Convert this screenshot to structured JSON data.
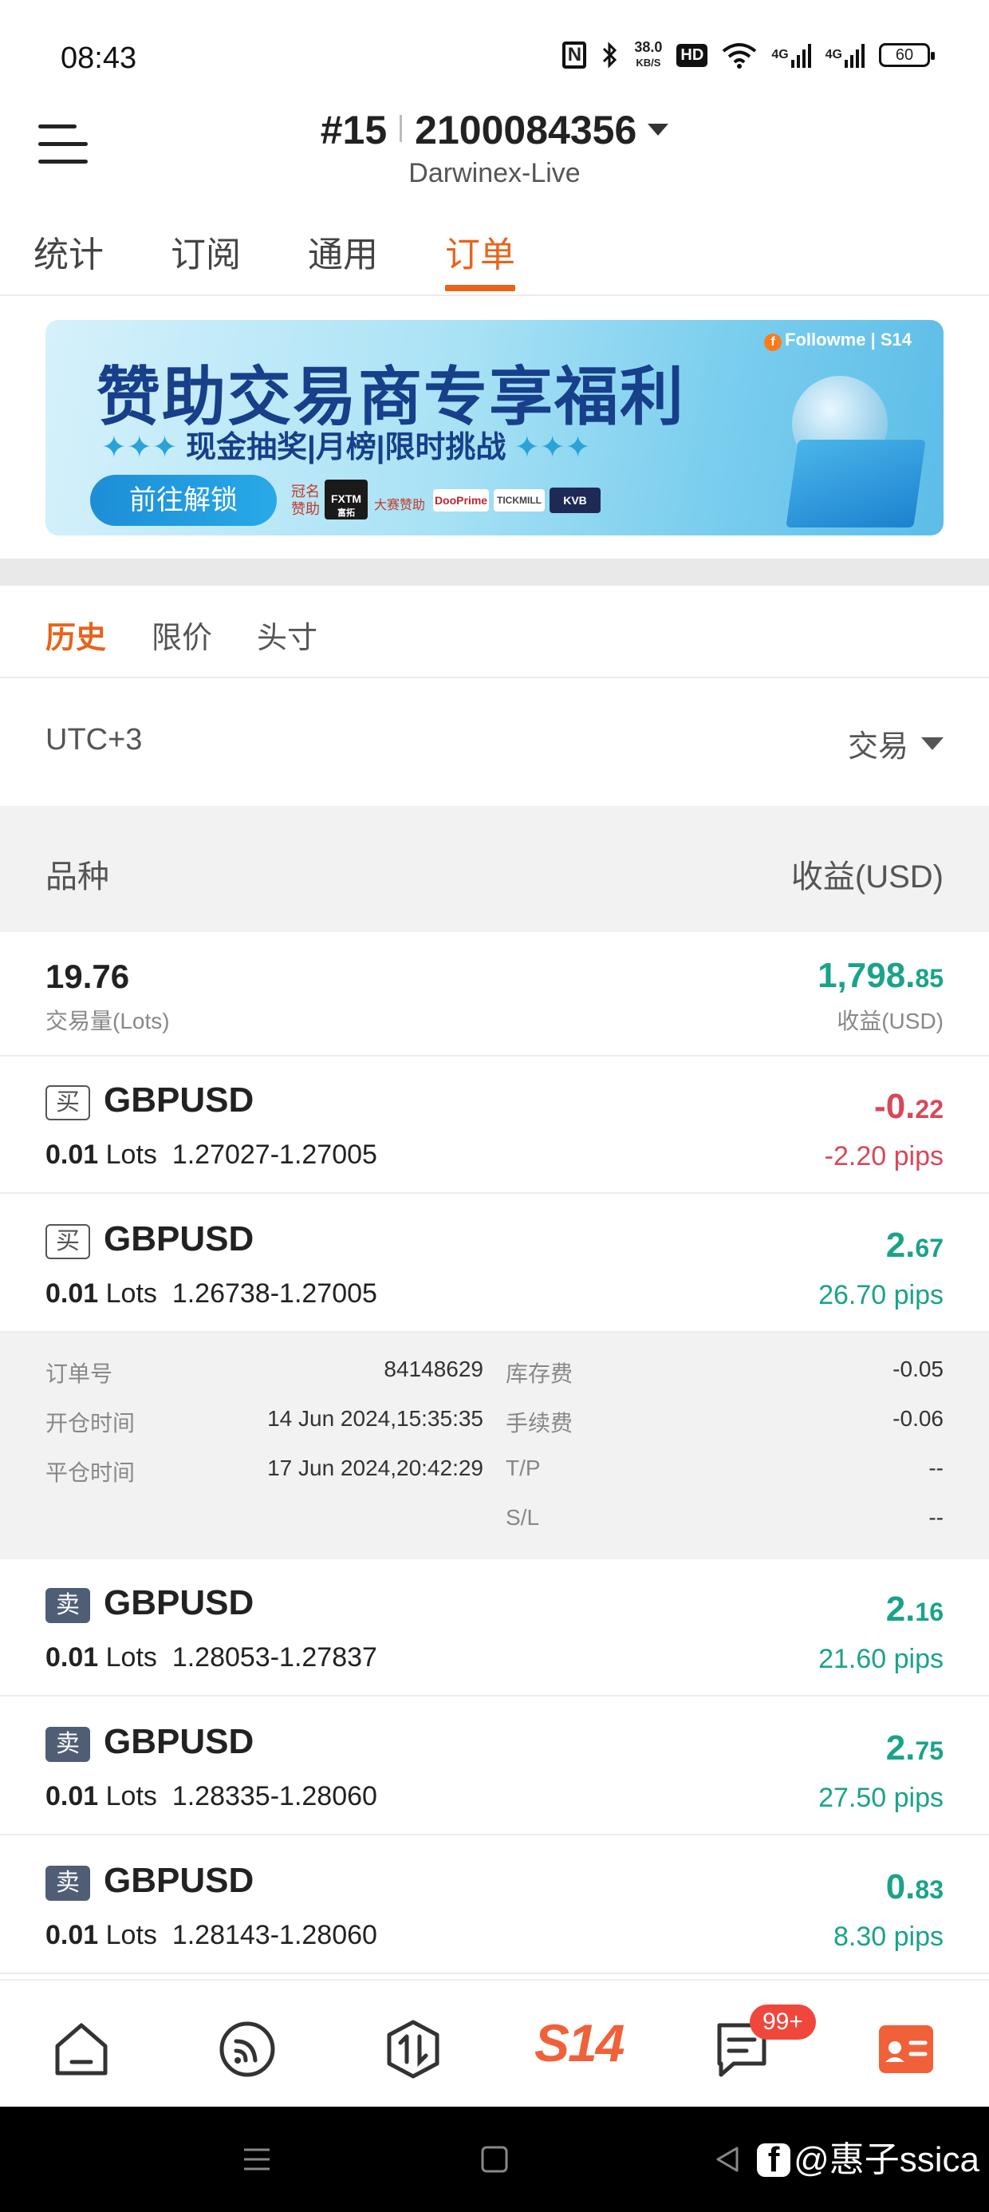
{
  "status_bar": {
    "time": "08:43",
    "nfc": "N",
    "speed_value": "38.0",
    "speed_unit": "KB/S",
    "hd": "HD",
    "signal1": "4G",
    "signal2": "4G",
    "battery": "60"
  },
  "header": {
    "account_index": "#15",
    "account_number": "2100084356",
    "broker": "Darwinex-Live"
  },
  "top_tabs": [
    {
      "label": "统计"
    },
    {
      "label": "订阅"
    },
    {
      "label": "通用"
    },
    {
      "label": "订单"
    }
  ],
  "top_tab_active": "订单",
  "banner": {
    "title": "赞助交易商专享福利",
    "subtitle": "现金抽奖|月榜|限时挑战",
    "button": "前往解锁",
    "sponsor_label": "冠名赞助",
    "sponsor_label2": "大赛赞助",
    "sponsor_fxtm": "FXTM",
    "sponsor_fxtm_sub": "富拓",
    "sponsor_2": "DooPrime",
    "sponsor_3": "TICKMILL",
    "sponsor_4": "KVB",
    "brand": "Followme",
    "brand_tag": "S14"
  },
  "sub_tabs": [
    {
      "label": "历史"
    },
    {
      "label": "限价"
    },
    {
      "label": "头寸"
    }
  ],
  "sub_tab_active": "历史",
  "filter": {
    "timezone": "UTC+3",
    "type_select": "交易"
  },
  "columns": {
    "left": "品种",
    "right": "收益(USD)"
  },
  "summary": {
    "volume": "19.76",
    "volume_label": "交易量(Lots)",
    "profit_main": "1,798.",
    "profit_decimal": "85",
    "profit_label": "收益(USD)"
  },
  "orders": [
    {
      "side": "买",
      "symbol": "GBPUSD",
      "lots": "0.01",
      "lots_unit": "Lots",
      "prices": "1.27027-1.27005",
      "pnl_main": "-0.",
      "pnl_decimal": "22",
      "pips": "-2.20 pips",
      "sign": "neg"
    },
    {
      "side": "买",
      "symbol": "GBPUSD",
      "lots": "0.01",
      "lots_unit": "Lots",
      "prices": "1.26738-1.27005",
      "pnl_main": "2.",
      "pnl_decimal": "67",
      "pips": "26.70 pips",
      "sign": "pos"
    },
    {
      "side": "卖",
      "symbol": "GBPUSD",
      "lots": "0.01",
      "lots_unit": "Lots",
      "prices": "1.28053-1.27837",
      "pnl_main": "2.",
      "pnl_decimal": "16",
      "pips": "21.60 pips",
      "sign": "pos"
    },
    {
      "side": "卖",
      "symbol": "GBPUSD",
      "lots": "0.01",
      "lots_unit": "Lots",
      "prices": "1.28335-1.28060",
      "pnl_main": "2.",
      "pnl_decimal": "75",
      "pips": "27.50 pips",
      "sign": "pos"
    },
    {
      "side": "卖",
      "symbol": "GBPUSD",
      "lots": "0.01",
      "lots_unit": "Lots",
      "prices": "1.28143-1.28060",
      "pnl_main": "0.",
      "pnl_decimal": "83",
      "pips": "8.30 pips",
      "sign": "pos"
    }
  ],
  "detail": {
    "order_no_label": "订单号",
    "order_no": "84148629",
    "open_time_label": "开仓时间",
    "open_time": "14 Jun 2024,15:35:35",
    "close_time_label": "平仓时间",
    "close_time": "17 Jun 2024,20:42:29",
    "swap_label": "库存费",
    "swap": "-0.05",
    "commission_label": "手续费",
    "commission": "-0.06",
    "tp_label": "T/P",
    "tp": "--",
    "sl_label": "S/L",
    "sl": "--"
  },
  "bottom_nav": {
    "items": [
      "home-icon",
      "feed-icon",
      "trade-icon",
      "s14-logo",
      "messages-icon",
      "profile-icon"
    ],
    "s14": "S14",
    "badge": "99+"
  },
  "watermark": "@惠子ssica",
  "colors": {
    "accent": "#e8631b",
    "positive": "#1aa389",
    "negative": "#d9475a",
    "sell_badge": "#4f5d75"
  }
}
